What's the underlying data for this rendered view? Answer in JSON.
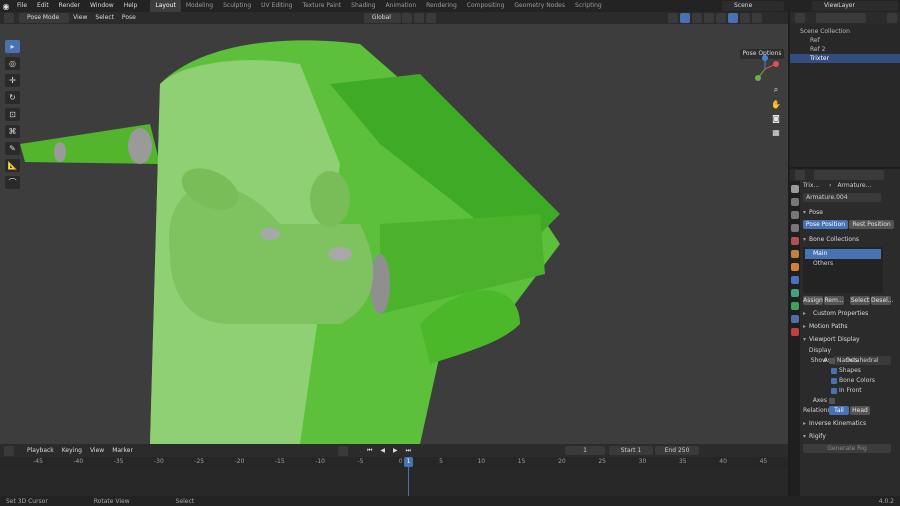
{
  "menus": [
    "File",
    "Edit",
    "Render",
    "Window",
    "Help"
  ],
  "workspaces": [
    "Layout",
    "Modeling",
    "Sculpting",
    "UV Editing",
    "Texture Paint",
    "Shading",
    "Animation",
    "Rendering",
    "Compositing",
    "Geometry Nodes",
    "Scripting"
  ],
  "active_workspace": "Layout",
  "scene": "Scene",
  "view_layer": "ViewLayer",
  "viewport_header": {
    "mode": "Pose Mode",
    "menu": [
      "View",
      "Select",
      "Pose"
    ],
    "orientation": "Global"
  },
  "pose_options": "Pose Options",
  "outliner": {
    "rows": [
      {
        "label": "Scene Collection"
      },
      {
        "label": "Ref",
        "selected": false
      },
      {
        "label": "Ref 2",
        "selected": false
      },
      {
        "label": "Trixter",
        "selected": true
      }
    ]
  },
  "properties": {
    "breadcrumb_object": "Trix...",
    "breadcrumb_data": "Armature...",
    "data_name": "Armature.004",
    "pose": {
      "title": "Pose",
      "pose_position": "Pose Position",
      "rest_position": "Rest Position"
    },
    "bone_collections": {
      "title": "Bone Collections",
      "items": [
        "Main",
        "Others"
      ],
      "assign": "Assign",
      "remove": "Rem...",
      "select": "Select",
      "deselect": "Desel..."
    },
    "custom_properties": "Custom Properties",
    "motion_paths": "Motion Paths",
    "viewport_display": {
      "title": "Viewport Display",
      "display_as_label": "Display As",
      "display_as_value": "Octahedral",
      "show_label": "Show",
      "names": "Names",
      "shapes": "Shapes",
      "bone_colors": "Bone Colors",
      "in_front": "In Front",
      "axes": "Axes",
      "relations": "Relations",
      "tail": "Tail",
      "head": "Head"
    },
    "inverse_kinematics": "Inverse Kinematics",
    "rigify": "Rigify",
    "generate_rig": "Generate Rig"
  },
  "timeline": {
    "menu": [
      "Playback",
      "Keying",
      "View",
      "Marker"
    ],
    "current_frame": "1",
    "start_label": "Start",
    "start": "1",
    "end_label": "End",
    "end": "250",
    "ticks": [
      "-45",
      "-40",
      "-35",
      "-30",
      "-25",
      "-20",
      "-15",
      "-10",
      "-5",
      "0",
      "5",
      "10",
      "15",
      "20",
      "25",
      "30",
      "35",
      "40",
      "45"
    ],
    "playhead": "1"
  },
  "status": {
    "item1": "Set 3D Cursor",
    "item2": "Rotate View",
    "item3": "Select",
    "version": "4.0.2"
  }
}
